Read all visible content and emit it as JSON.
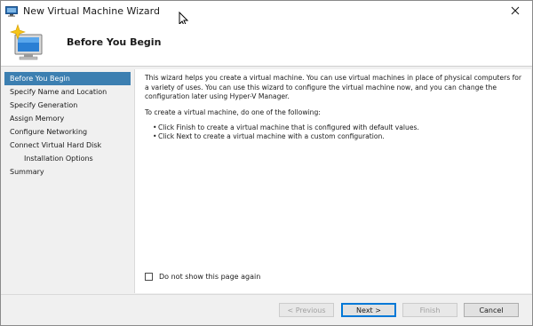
{
  "window": {
    "title": "New Virtual Machine Wizard"
  },
  "header": {
    "title": "Before You Begin"
  },
  "nav": {
    "items": [
      {
        "label": "Before You Begin",
        "selected": true
      },
      {
        "label": "Specify Name and Location"
      },
      {
        "label": "Specify Generation"
      },
      {
        "label": "Assign Memory"
      },
      {
        "label": "Configure Networking"
      },
      {
        "label": "Connect Virtual Hard Disk"
      },
      {
        "label": "Installation Options",
        "indent": true
      },
      {
        "label": "Summary"
      }
    ]
  },
  "content": {
    "intro": "This wizard helps you create a virtual machine. You can use virtual machines in place of physical computers for a variety of uses. You can use this wizard to configure the virtual machine now, and you can change the configuration later using Hyper-V Manager.",
    "instruction": "To create a virtual machine, do one of the following:",
    "bullets": [
      "Click Finish to create a virtual machine that is configured with default values.",
      "Click Next to create a virtual machine with a custom configuration."
    ],
    "checkbox_label": "Do not show this page again",
    "checkbox_checked": false
  },
  "buttons": {
    "previous": "< Previous",
    "next": "Next >",
    "finish": "Finish",
    "cancel": "Cancel"
  },
  "colors": {
    "selection": "#3c7fb1",
    "default_button_border": "#0078d7"
  }
}
